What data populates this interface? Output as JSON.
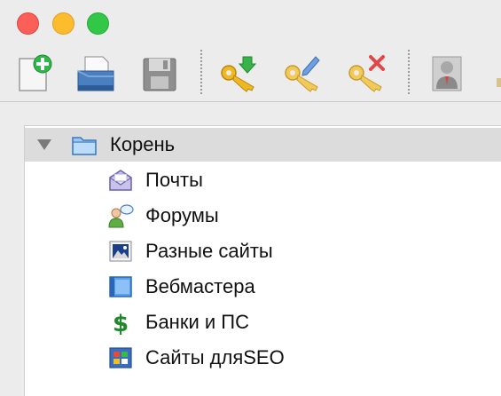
{
  "window": {
    "controls": [
      "close",
      "minimize",
      "zoom"
    ]
  },
  "toolbar": {
    "buttons": [
      {
        "icon": "new-document-icon"
      },
      {
        "icon": "open-document-icon"
      },
      {
        "icon": "save-disk-icon"
      },
      {
        "icon": "key-add-icon"
      },
      {
        "icon": "key-edit-icon"
      },
      {
        "icon": "key-delete-icon"
      },
      {
        "icon": "user-card-icon"
      }
    ]
  },
  "tree": {
    "root": {
      "label": "Корень",
      "icon": "folder-icon",
      "expanded": true
    },
    "children": [
      {
        "label": "Почты",
        "icon": "mail-icon"
      },
      {
        "label": "Форумы",
        "icon": "forum-icon"
      },
      {
        "label": "Разные сайты",
        "icon": "picture-icon"
      },
      {
        "label": "Вебмастера",
        "icon": "webmaster-window-icon"
      },
      {
        "label": "Банки и ПС",
        "icon": "dollar-icon"
      },
      {
        "label": "Сайты дляSEO",
        "icon": "seo-grid-icon"
      }
    ]
  },
  "colors": {
    "selection": "#dcdcdc",
    "close": "#fc5f57",
    "minimize": "#fdbc2e",
    "zoom": "#33c748",
    "dollar": "#1f8a2a"
  }
}
